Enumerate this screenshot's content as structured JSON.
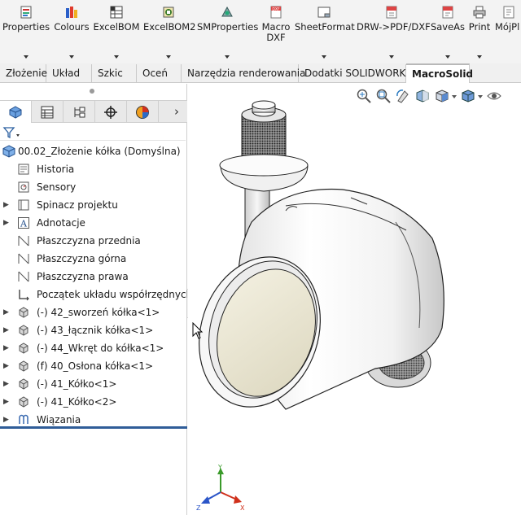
{
  "toolbar": {
    "buttons": [
      {
        "label": "Properties",
        "icon": "properties-icon"
      },
      {
        "label": "Colours",
        "icon": "colours-icon"
      },
      {
        "label": "ExcelBOM",
        "icon": "excelbom-icon"
      },
      {
        "label": "ExcelBOM2",
        "icon": "excelbom2-icon"
      },
      {
        "label": "SMProperties",
        "icon": "smproperties-icon"
      },
      {
        "label": "Macro",
        "label2": "DXF",
        "icon": "macro-dxf-icon"
      },
      {
        "label": "SheetFormat",
        "icon": "sheetformat-icon"
      },
      {
        "label": "DRW->PDF/DXF",
        "icon": "drw-pdf-dxf-icon"
      },
      {
        "label": "SaveAs",
        "icon": "saveas-icon"
      },
      {
        "label": "Print",
        "icon": "print-icon"
      },
      {
        "label": "MójPl",
        "icon": "mojpl-icon"
      }
    ]
  },
  "tabs": [
    {
      "label": "Złożenie"
    },
    {
      "label": "Układ"
    },
    {
      "label": "Szkic"
    },
    {
      "label": "Oceń"
    },
    {
      "label": "Narzędzia renderowania"
    },
    {
      "label": "Dodatki SOLIDWORKS"
    },
    {
      "label": "MacroSolid",
      "active": true
    }
  ],
  "panel": {
    "tabs": [
      "feature-manager-icon",
      "property-manager-icon",
      "configuration-manager-icon",
      "dimxpert-icon",
      "display-manager-icon"
    ],
    "tree": {
      "root": "00.02_Złożenie kółka  (Domyślna)",
      "items": [
        {
          "label": "Historia",
          "icon": "history-icon",
          "expandable": false
        },
        {
          "label": "Sensory",
          "icon": "sensors-icon",
          "expandable": false
        },
        {
          "label": "Spinacz projektu",
          "icon": "design-binder-icon",
          "expandable": true
        },
        {
          "label": "Adnotacje",
          "icon": "annotations-icon",
          "expandable": true
        },
        {
          "label": "Płaszczyzna przednia",
          "icon": "plane-icon",
          "expandable": false
        },
        {
          "label": "Płaszczyzna górna",
          "icon": "plane-icon",
          "expandable": false
        },
        {
          "label": "Płaszczyzna prawa",
          "icon": "plane-icon",
          "expandable": false
        },
        {
          "label": "Początek układu współrzędnych",
          "icon": "origin-icon",
          "expandable": false
        },
        {
          "label": "(-) 42_sworzeń kółka<1>",
          "icon": "part-icon",
          "expandable": true
        },
        {
          "label": "(-) 43_łącznik kółka<1>",
          "icon": "part-icon",
          "expandable": true
        },
        {
          "label": "(-) 44_Wkręt do kółka<1>",
          "icon": "part-icon",
          "expandable": true
        },
        {
          "label": "(f) 40_Osłona kółka<1>",
          "icon": "part-icon",
          "expandable": true
        },
        {
          "label": "(-) 41_Kółko<1>",
          "icon": "part-icon",
          "expandable": true
        },
        {
          "label": "(-) 41_Kółko<2>",
          "icon": "part-icon",
          "expandable": true
        },
        {
          "label": "Wiązania",
          "icon": "mates-icon",
          "expandable": true
        }
      ]
    }
  },
  "triad": {
    "x": "X",
    "y": "Y",
    "z": "Z"
  },
  "colors": {
    "accent": "#2f5d98",
    "axis_x": "#d0301b",
    "axis_y": "#3a9a2a",
    "axis_z": "#2b55c8"
  }
}
